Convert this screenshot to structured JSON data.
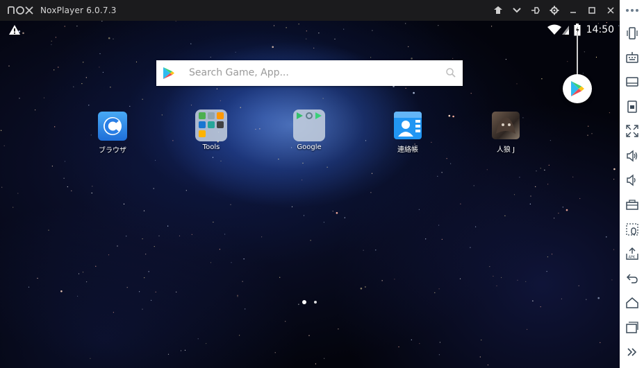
{
  "window": {
    "title": "NoxPlayer 6.0.7.3",
    "brand": "nox"
  },
  "title_controls": [
    {
      "name": "keymap-icon"
    },
    {
      "name": "dropdown-icon"
    },
    {
      "name": "pin-icon"
    },
    {
      "name": "settings-icon"
    },
    {
      "name": "minimize-icon"
    },
    {
      "name": "maximize-icon"
    },
    {
      "name": "close-icon"
    }
  ],
  "status_bar": {
    "time": "14:50"
  },
  "search": {
    "placeholder": "Search Game, App..."
  },
  "apps": [
    {
      "label": "ブラウザ",
      "icon": "browser-icon"
    },
    {
      "label": "Tools",
      "icon": "tools-folder-icon"
    },
    {
      "label": "Google",
      "icon": "google-folder-icon"
    },
    {
      "label": "連絡帳",
      "icon": "contacts-icon"
    },
    {
      "label": "人狼 J",
      "icon": "jinrou-game-icon"
    }
  ],
  "page_indicator": {
    "pages": 2,
    "current": 1
  },
  "sidebar": {
    "more": "more-icon",
    "tools": [
      "shake-icon",
      "virtual-keyboard-icon",
      "screen-icon",
      "screenshot-icon",
      "fullscreen-icon",
      "volume-up-icon",
      "volume-down-icon",
      "toolbox-icon",
      "location-icon",
      "apk-install-icon",
      "back-icon",
      "home-icon",
      "recent-apps-icon",
      "expand-icon"
    ]
  },
  "colors": {
    "titlebar": "#1b1b1d",
    "sidebar": "#ffffff",
    "accent_blue": "#2f86e8"
  }
}
